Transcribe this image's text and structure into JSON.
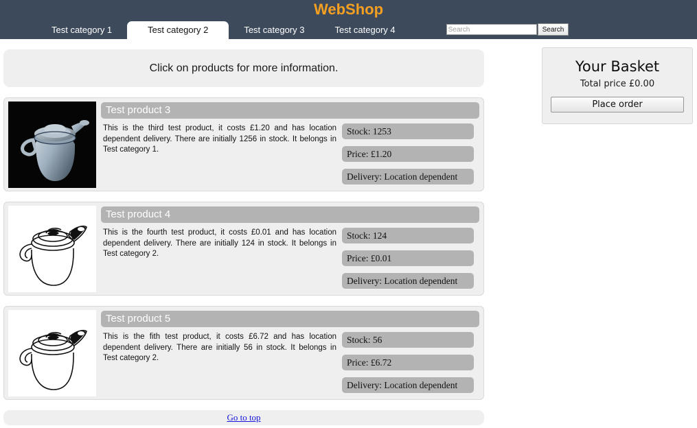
{
  "header": {
    "site_title": "WebShop",
    "brand_color": "#f5a020",
    "bar_color": "#3d4a5c",
    "tabs": [
      {
        "label": "Test category 1",
        "active": false
      },
      {
        "label": "Test category 2",
        "active": true
      },
      {
        "label": "Test category 3",
        "active": false
      },
      {
        "label": "Test category 4",
        "active": false
      }
    ],
    "search": {
      "placeholder": "Search",
      "value": "",
      "button_label": "Search"
    }
  },
  "main": {
    "info_banner": "Click on products for more information.",
    "products": [
      {
        "name": "Test product 3",
        "description": "This is the third test product, it costs £1.20 and has location dependent delivery. There are initially 1256 in stock. It belongs in Test category 1.",
        "stock_label": "Stock: 1253",
        "price_label": "Price: £1.20",
        "delivery_label": "Delivery: Location dependent",
        "image": "teapot-photo"
      },
      {
        "name": "Test product 4",
        "description": "This is the fourth test product, it costs £0.01 and has location dependent delivery. There are initially 124 in stock. It belongs in Test category 2.",
        "stock_label": "Stock: 124",
        "price_label": "Price: £0.01",
        "delivery_label": "Delivery: Location dependent",
        "image": "teapot-lineart"
      },
      {
        "name": "Test product 5",
        "description": "This is the fith test product, it costs £6.72 and has location dependent delivery. There are initially 56 in stock. It belongs in Test category 2.",
        "stock_label": "Stock: 56",
        "price_label": "Price: £6.72",
        "delivery_label": "Delivery: Location dependent",
        "image": "teapot-lineart"
      }
    ],
    "footer_link": "Go to top"
  },
  "basket": {
    "title": "Your Basket",
    "total_price": "Total price £0.00",
    "place_order_label": "Place order"
  }
}
